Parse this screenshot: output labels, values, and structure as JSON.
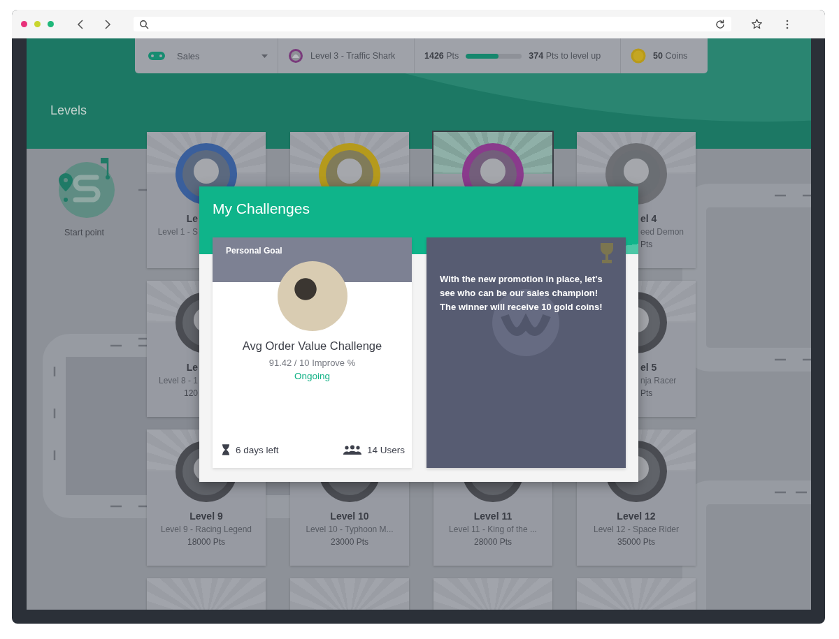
{
  "stats_bar": {
    "team": "Sales",
    "level": "Level 3 - Traffic Shark",
    "points": "**1426** Pts",
    "progress": {
      "level": 0.58
    },
    "to_next": "**374** Pts to level up",
    "coins": "**50** Coins"
  },
  "page_title": "Levels",
  "start_point": "Start point",
  "level_rows": [
    {
      "levels": [
        {
          "title": "Le",
          "subtitle": "Level 1 - S",
          "color": "#3a5f9c",
          "current": false
        },
        {
          "color": "#b59a1c",
          "current": false
        },
        {
          "color": "#8a3a8c",
          "current": true
        },
        {
          "title": "el 4",
          "subtitle": "eed Demon",
          "points": "Pts",
          "color": "#6d6f74",
          "current": false
        }
      ]
    },
    {
      "levels": [
        {
          "title": "Le",
          "subtitle": "Level 8 - 1",
          "points": "120",
          "color": "#4a4c52",
          "current": false
        },
        {
          "title": "el 5",
          "subtitle": "nja Racer",
          "points": "Pts",
          "color": "#4a4c52",
          "current": false
        }
      ]
    },
    {
      "levels": [
        {
          "title": "Level 9",
          "subtitle": "Level 9 - Racing Legend",
          "points": "18000 Pts",
          "color": "#4a4c52",
          "current": false
        },
        {
          "title": "Level 10",
          "subtitle": "Level 10 - Typhoon M...",
          "points": "23000 Pts",
          "color": "#4a4c52",
          "current": false
        },
        {
          "title": "Level 11",
          "subtitle": "Level 11 - King of the ...",
          "points": "28000 Pts",
          "color": "#4a4c52",
          "current": false
        },
        {
          "title": "Level 12",
          "subtitle": "Level 12 - Space Rider",
          "points": "35000 Pts",
          "color": "#4a4c52",
          "current": false
        }
      ]
    },
    {
      "levels": [
        {
          "current": false
        },
        {
          "current": false
        },
        {
          "current": false
        },
        {
          "current": false
        }
      ]
    }
  ],
  "modal": {
    "title": "My Challenges",
    "challenges": [
      {
        "kind": "front",
        "category": "Personal Goal",
        "title": "Avg Order Value Challenge",
        "progress": "91.42 / 10 Improve %",
        "status": "Ongoing",
        "time_left": "6 days left",
        "users": "14 Users"
      },
      {
        "kind": "flipped",
        "description": "With the new promotion in place, let's see who can be our sales champion! The winner will receive 10 gold coins!"
      }
    ]
  }
}
